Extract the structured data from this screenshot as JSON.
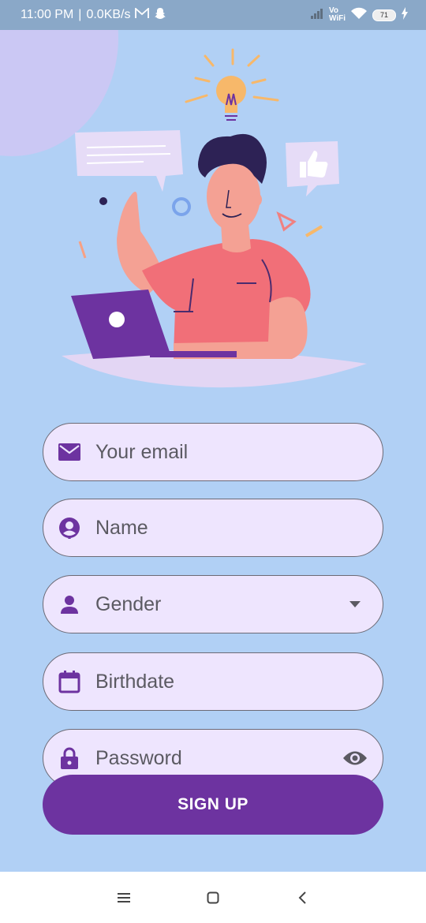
{
  "status_bar": {
    "time": "11:00 PM",
    "network_speed": "0.0KB/s",
    "carrier_label_top": "Vo",
    "carrier_label_bottom": "WiFi",
    "battery": "71"
  },
  "form": {
    "email": {
      "placeholder": "Your email",
      "icon": "mail-icon"
    },
    "name": {
      "placeholder": "Name",
      "icon": "account-circle-icon"
    },
    "gender": {
      "placeholder": "Gender",
      "icon": "person-icon",
      "trailing_icon": "dropdown-arrow-icon"
    },
    "birthdate": {
      "placeholder": "Birthdate",
      "icon": "calendar-icon"
    },
    "password": {
      "placeholder": "Password",
      "icon": "lock-icon",
      "trailing_icon": "eye-icon"
    }
  },
  "signup_button": {
    "label": "SIGN UP"
  },
  "colors": {
    "background": "#b1d0f5",
    "accent": "#6d33a0",
    "field_fill": "#eee5fe"
  },
  "nav_bar": {
    "menu_icon": "menu-icon",
    "home_icon": "home-square-icon",
    "back_icon": "back-chevron-icon"
  }
}
